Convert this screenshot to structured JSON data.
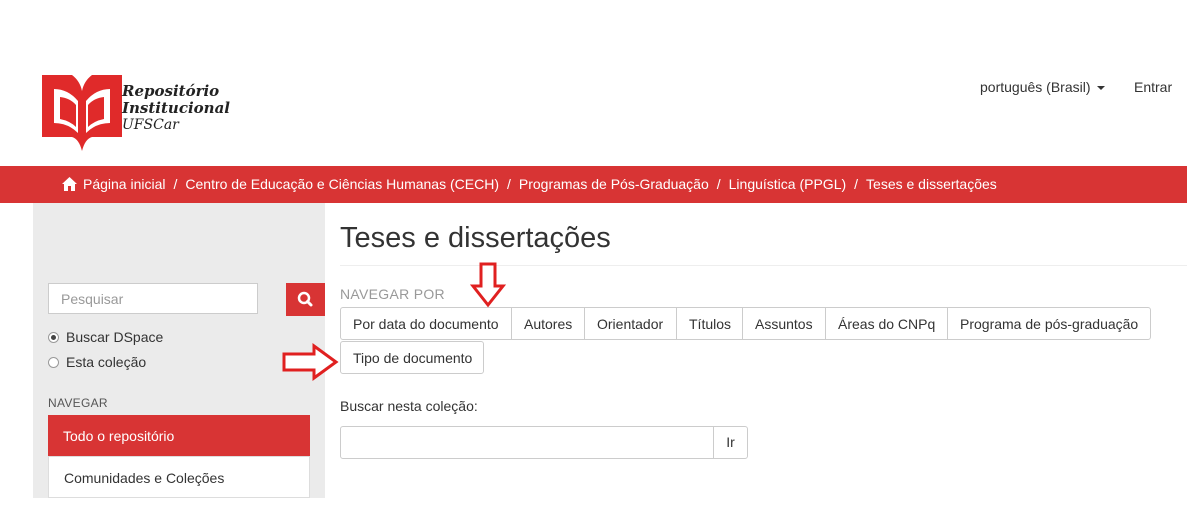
{
  "header": {
    "logo_line1": "Repositório",
    "logo_line2": "Institucional",
    "logo_line3": "UFSCar",
    "language": "português (Brasil)",
    "login": "Entrar"
  },
  "breadcrumb": {
    "items": [
      "Página inicial",
      "Centro de Educação e Ciências Humanas (CECH)",
      "Programas de Pós-Graduação",
      "Linguística (PPGL)",
      "Teses e dissertações"
    ],
    "separator": "/"
  },
  "sidebar": {
    "search_placeholder": "Pesquisar",
    "scope_options": [
      "Buscar DSpace",
      "Esta coleção"
    ],
    "nav_heading": "NAVEGAR",
    "nav_items": [
      "Todo o repositório",
      "Comunidades e Coleções"
    ]
  },
  "main": {
    "title": "Teses e dissertações",
    "browse_heading": "NAVEGAR POR",
    "browse_buttons": [
      "Por data do documento",
      "Autores",
      "Orientador",
      "Títulos",
      "Assuntos",
      "Áreas do CNPq",
      "Programa de pós-graduação",
      "Tipo de documento"
    ],
    "search_label": "Buscar nesta coleção:",
    "search_button": "Ir"
  },
  "colors": {
    "brand_red": "#d83434",
    "sidebar_bg": "#ebebeb",
    "annotation_arrow": "#e02020"
  }
}
